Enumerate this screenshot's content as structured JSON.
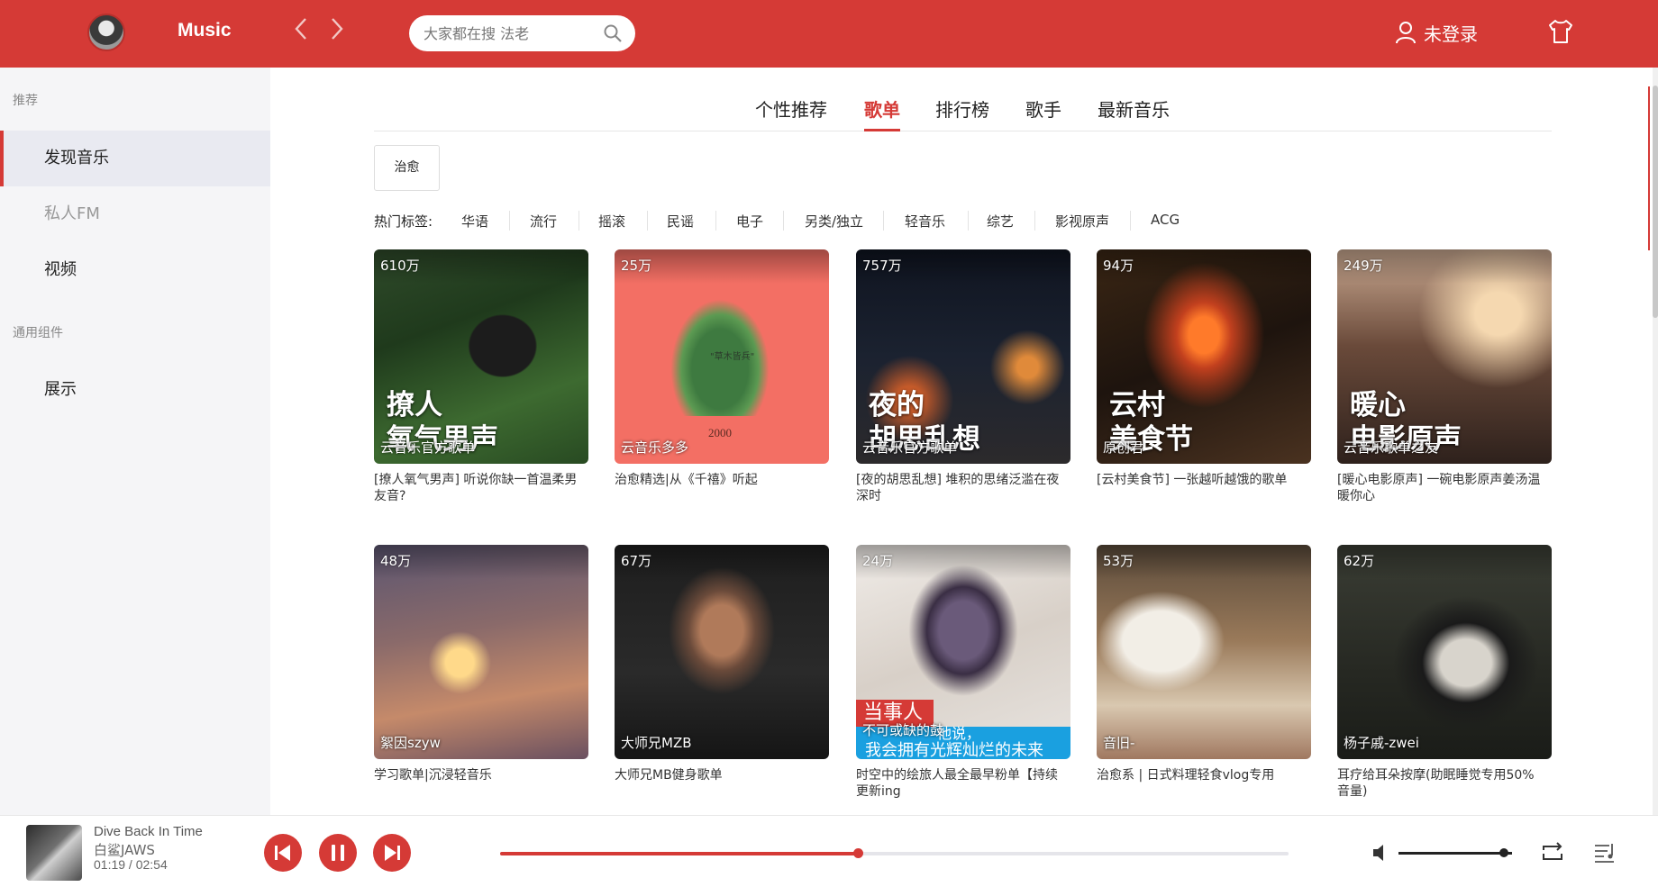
{
  "header": {
    "brand": "Music",
    "search_placeholder": "大家都在搜 法老",
    "login_label": "未登录",
    "accent": "#d53a36"
  },
  "sidebar": {
    "section_recommend": "推荐",
    "section_components": "通用组件",
    "items": [
      {
        "label": "发现音乐"
      },
      {
        "label": "私人FM"
      },
      {
        "label": "视频"
      },
      {
        "label": "展示"
      }
    ]
  },
  "tabs": [
    "个性推荐",
    "歌单",
    "排行榜",
    "歌手",
    "最新音乐"
  ],
  "active_tab": "歌单",
  "category_button": "治愈",
  "hot_tags": {
    "label": "热门标签:",
    "tags": [
      "华语",
      "流行",
      "摇滚",
      "民谣",
      "电子",
      "另类/独立",
      "轻音乐",
      "综艺",
      "影视原声",
      "ACG"
    ]
  },
  "playlists": [
    {
      "count": "610万",
      "cover_title_1": "撩人",
      "cover_title_2": "氧气男声",
      "creator": "云音乐官方歌单",
      "desc": "[撩人氧气男声] 听说你缺一首温柔男友音?"
    },
    {
      "count": "25万",
      "cover_title_1": "",
      "cover_title_2": "",
      "creator": "云音乐多多",
      "desc": "治愈精选|从《千禧》听起"
    },
    {
      "count": "757万",
      "cover_title_1": "夜的",
      "cover_title_2": "胡思乱想",
      "creator": "云音乐官方歌单",
      "desc": "[夜的胡思乱想] 堆积的思绪泛滥在夜深时"
    },
    {
      "count": "94万",
      "cover_title_1": "云村",
      "cover_title_2": "美食节",
      "creator": "原创君",
      "desc": "[云村美食节] 一张越听越饿的歌单"
    },
    {
      "count": "249万",
      "cover_title_1": "暖心",
      "cover_title_2": "电影原声",
      "creator": "云音乐歌单之友",
      "desc": "[暖心电影原声] 一碗电影原声姜汤温暖你心"
    },
    {
      "count": "48万",
      "cover_title_1": "",
      "cover_title_2": "",
      "creator": "絮因szyw",
      "desc": "学习歌单|沉浸轻音乐"
    },
    {
      "count": "67万",
      "cover_title_1": "",
      "cover_title_2": "",
      "creator": "大师兄MZB",
      "desc": "大师兄MB健身歌单"
    },
    {
      "count": "24万",
      "cover_title_1": "",
      "cover_title_2": "",
      "creator": "不可或缺的鼓",
      "desc": "时空中的绘旅人最全最早粉单【持续更新ing"
    },
    {
      "count": "53万",
      "cover_title_1": "",
      "cover_title_2": "",
      "creator": "音旧-",
      "desc": "治愈系 | 日式料理轻食vlog专用"
    },
    {
      "count": "62万",
      "cover_title_1": "",
      "cover_title_2": "",
      "creator": "杨子戚-zwei",
      "desc": "耳疗给耳朵按摩(助眠睡觉专用50%音量)"
    }
  ],
  "cover_art_text": {
    "c2_center": "\"草木皆兵\"",
    "c2_year": "2000",
    "c8_red": "当事人",
    "c8_caption_1": "他说，",
    "c8_caption_2": "我会拥有光辉灿烂的未来"
  },
  "player": {
    "title": "Dive Back In Time",
    "artist": "白鲨JAWS",
    "time": "01:19 / 02:54",
    "progress": 0.454,
    "volume": 0.93
  },
  "icons": [
    "search-icon",
    "user-icon",
    "shirt-icon",
    "prev-icon",
    "pause-icon",
    "next-icon",
    "volume-icon",
    "loop-icon",
    "playlist-icon"
  ]
}
